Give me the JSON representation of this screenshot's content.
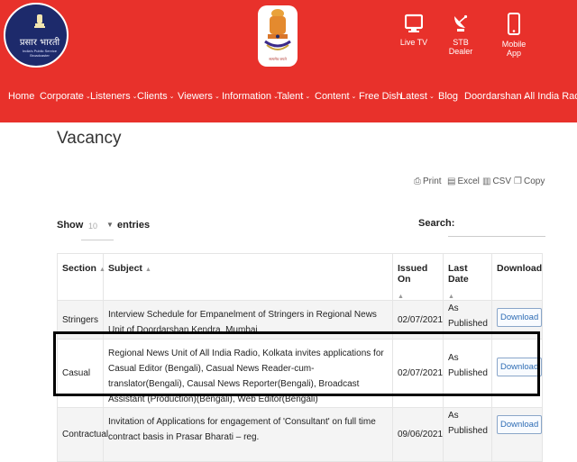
{
  "header": {
    "logo_text": "प्रसार भारती",
    "logo_subtext": "India's Public Service Broadcaster",
    "emblem_caption": "सत्यमेव जयते",
    "links": [
      {
        "label": "Live TV",
        "icon": "tv-icon"
      },
      {
        "label": "STB Dealer",
        "icon": "satellite-dish-icon"
      },
      {
        "label": "Mobile App",
        "icon": "mobile-phone-icon"
      }
    ]
  },
  "nav": {
    "items": [
      "Home",
      "Corporate",
      "Listeners",
      "Clients",
      "Viewers",
      "Information",
      "Talent",
      "Content",
      "Free Dish",
      "Latest",
      "Blog",
      "Doordarshan",
      "All India Radio"
    ]
  },
  "page": {
    "title": "Vacancy",
    "tools": [
      "Print",
      "Excel",
      "CSV",
      "Copy"
    ],
    "show_label": "Show",
    "entries_value": "10",
    "entries_label": "entries",
    "search_label": "Search:"
  },
  "table": {
    "headers": [
      "Section",
      "Subject",
      "Issued On",
      "Last Date",
      "Download"
    ],
    "rows": [
      {
        "section": "Stringers",
        "subject": "Interview Schedule for Empanelment of Stringers in Regional News Unit of Doordarshan Kendra, Mumbai",
        "issued": "02/07/2021",
        "last_date": "As Published",
        "download": "Download"
      },
      {
        "section": "Casual",
        "subject": "Regional News Unit of All India Radio, Kolkata invites applications for Casual Editor (Bengali), Casual News Reader-cum-translator(Bengali), Causal News Reporter(Bengali), Broadcast Assistant (Production)(Bengali), Web Editor(Bengali)",
        "issued": "02/07/2021",
        "last_date": "As Published",
        "download": "Download"
      },
      {
        "section": "Contractual",
        "subject": "Invitation of Applications for engagement of 'Consultant' on full time contract basis in Prasar Bharati – reg.",
        "issued": "09/06/2021",
        "last_date": "As Published",
        "download": "Download"
      }
    ]
  },
  "colors": {
    "header_red": "#e8312b",
    "logo_navy": "#1d2a6b",
    "link_blue": "#2f6db5",
    "highlight": "#000000"
  }
}
